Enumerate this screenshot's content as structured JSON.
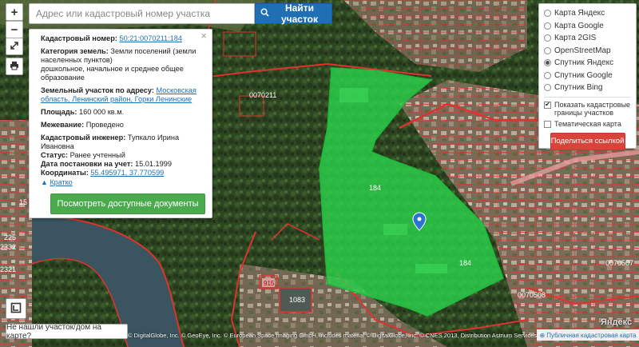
{
  "search": {
    "placeholder": "Адрес или кадастровый номер участка",
    "button_label": "Найти участок"
  },
  "controls": {
    "zoom_in": "+",
    "zoom_out": "−"
  },
  "info": {
    "cad_number_label": "Кадастровый номер:",
    "cad_number": "50:21:0070211:184",
    "category_label": "Категория земель:",
    "category": "Земли поселений (земли населенных пунктов)",
    "usage": "дошкольное, начальное и среднее общее образование",
    "address_label": "Земельный участок по адресу:",
    "address": "Московская область, Ленинский район, Горки Ленинские",
    "area_label": "Площадь:",
    "area": "160 000 кв.м.",
    "survey_label": "Межевание:",
    "survey": "Проведено",
    "engineer_label": "Кадастровый инженер:",
    "engineer": "Тупкало Ирина Ивановна",
    "status_label": "Статус:",
    "status": "Ранее учтенный",
    "date_label": "Дата постановки на учет:",
    "date": "15.01.1999",
    "coords_label": "Координаты:",
    "coords": "55.495971, 37.770599",
    "collapse": "Кратко",
    "docs_button": "Посмотреть доступные документы",
    "close": "×"
  },
  "layers": {
    "items": [
      {
        "label": "Карта Яндекс",
        "selected": false
      },
      {
        "label": "Карта Google",
        "selected": false
      },
      {
        "label": "Карта 2GIS",
        "selected": false
      },
      {
        "label": "OpenStreetMap",
        "selected": false
      },
      {
        "label": "Спутник Яндекс",
        "selected": true
      },
      {
        "label": "Спутник Google",
        "selected": false
      },
      {
        "label": "Спутник Bing",
        "selected": false
      }
    ],
    "show_boundaries": "Показать кадастровые границы участков",
    "show_boundaries_checked": true,
    "thematic": "Тематическая карта",
    "thematic_checked": false,
    "share_button": "Поделиться ссылкой"
  },
  "map": {
    "labels": {
      "block_main": "0070211",
      "plot_a": "184",
      "plot_b": "184",
      "block_right": "0070507",
      "block_bottom": "0070508",
      "house_915": "915",
      "house_1083": "1083",
      "num_225": "225",
      "num_2332": "2332",
      "num_2321": "2321",
      "num_15": "15",
      "num_3012": "3012"
    },
    "colors": {
      "boundary": "#e0322e",
      "selected_fill": "#2bd14a",
      "forest": "#2f4a23",
      "river": "#3a5560",
      "marker": "#2a73d0"
    }
  },
  "bottom": {
    "not_found": "Не нашли участок/дом на карте?",
    "attribution": "© DigitalGlobe, Inc. © GeoEye, Inc. © European Space Imaging GmbH, includes material © DigitalGlobe, Inc. © CNES 2013, Distribution Astrium Services/Spot Image",
    "pkk_link": "Публичная кадастровая карта",
    "yandex_logo": "Яндекс"
  },
  "icons": {
    "search": "search-icon",
    "fullscreen": "expand-icon",
    "print": "printer-icon",
    "legend": "legend-icon",
    "marker": "map-pin-icon"
  }
}
